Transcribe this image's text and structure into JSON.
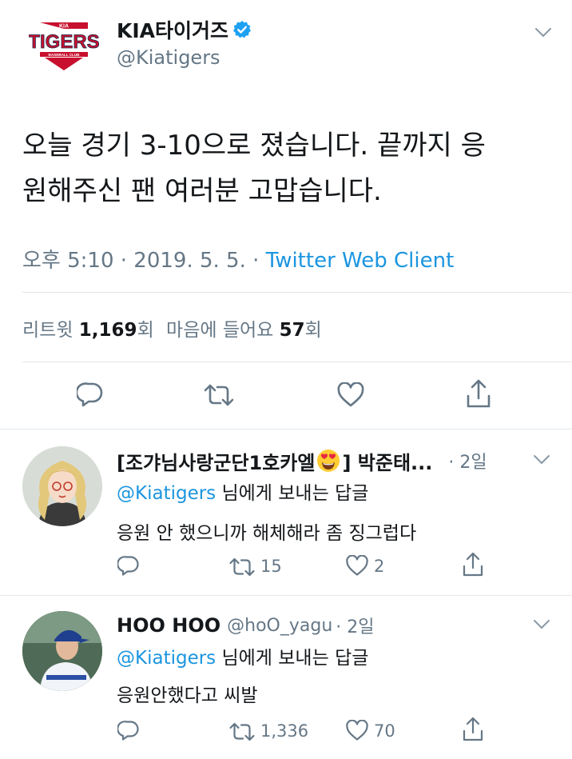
{
  "main_tweet": {
    "display_name": "KIA타이거즈",
    "handle": "@Kiatigers",
    "logo": {
      "top_text": "KIA",
      "main_text": "TIGERS",
      "sub_text": "BASEBALL CLUB"
    },
    "text_line1": "오늘 경기 3-10으로 졌습니다. 끝까지 응",
    "text_line2": "원해주신 팬 여러분 고맙습니다.",
    "meta_time": "오후 5:10 · 2019. 5. 5. · ",
    "meta_client": "Twitter Web Client",
    "retweets_label": "리트윗",
    "retweets_count": "1,169",
    "retweets_suffix": "회",
    "likes_label": "마음에 들어요",
    "likes_count": "57",
    "likes_suffix": "회"
  },
  "replies": [
    {
      "display_name": "[조갸님사랑군단1호카엘",
      "emoji": "heart-eyes-emoji",
      "display_name_tail": "] 박준태...",
      "time": "· 2일",
      "reply_to_handle": "@Kiatigers",
      "reply_to_suffix": " 님에게 보내는 답글",
      "text": "응원 안 했으니까 해체해라 좀 징그럽다",
      "retweet_count": "15",
      "like_count": "2"
    },
    {
      "display_name": "HOO HOO",
      "handle": "@hoO_yagu",
      "time": "· 2일",
      "reply_to_handle": "@Kiatigers",
      "reply_to_suffix": " 님에게 보내는 답글",
      "text": "응원안했다고 씨발",
      "retweet_count": "1,336",
      "like_count": "70"
    }
  ],
  "colors": {
    "link": "#1b95e0",
    "muted": "#657786",
    "logo_red": "#c8102e",
    "logo_navy": "#1d2b4f",
    "divider": "#e1e8ed"
  }
}
